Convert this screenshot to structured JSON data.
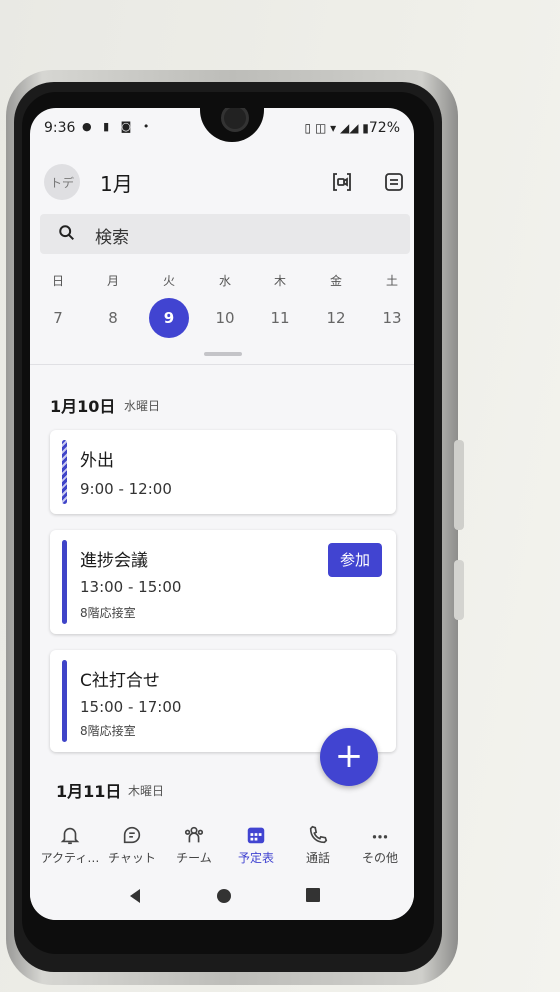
{
  "status_bar": {
    "time": "9:36",
    "battery": "72%"
  },
  "header": {
    "avatar_initials": "トデ",
    "month": "1月"
  },
  "search": {
    "placeholder": "検索"
  },
  "week": {
    "days": [
      {
        "weekday": "日",
        "date": "7",
        "selected": false
      },
      {
        "weekday": "月",
        "date": "8",
        "selected": false
      },
      {
        "weekday": "火",
        "date": "9",
        "selected": true
      },
      {
        "weekday": "水",
        "date": "10",
        "selected": false
      },
      {
        "weekday": "木",
        "date": "11",
        "selected": false
      },
      {
        "weekday": "金",
        "date": "12",
        "selected": false
      },
      {
        "weekday": "土",
        "date": "13",
        "selected": false
      }
    ]
  },
  "agenda": {
    "day1": {
      "date": "1月10日",
      "weekday": "水曜日"
    },
    "events": [
      {
        "title": "外出",
        "time": "9:00 - 12:00",
        "location": ""
      },
      {
        "title": "進捗会議",
        "time": "13:00 - 15:00",
        "location": "8階応接室",
        "join_label": "参加"
      },
      {
        "title": "C社打合せ",
        "time": "15:00 - 17:00",
        "location": "8階応接室"
      }
    ],
    "day2": {
      "date": "1月11日",
      "weekday": "木曜日"
    }
  },
  "fab": {
    "label": "+"
  },
  "bottom_nav": [
    {
      "label": "アクティ…",
      "icon": "bell-icon"
    },
    {
      "label": "チャット",
      "icon": "chat-icon"
    },
    {
      "label": "チーム",
      "icon": "team-icon"
    },
    {
      "label": "予定表",
      "icon": "calendar-icon",
      "active": true
    },
    {
      "label": "通話",
      "icon": "phone-icon"
    },
    {
      "label": "その他",
      "icon": "more-icon"
    }
  ],
  "colors": {
    "accent": "#4144d1"
  }
}
